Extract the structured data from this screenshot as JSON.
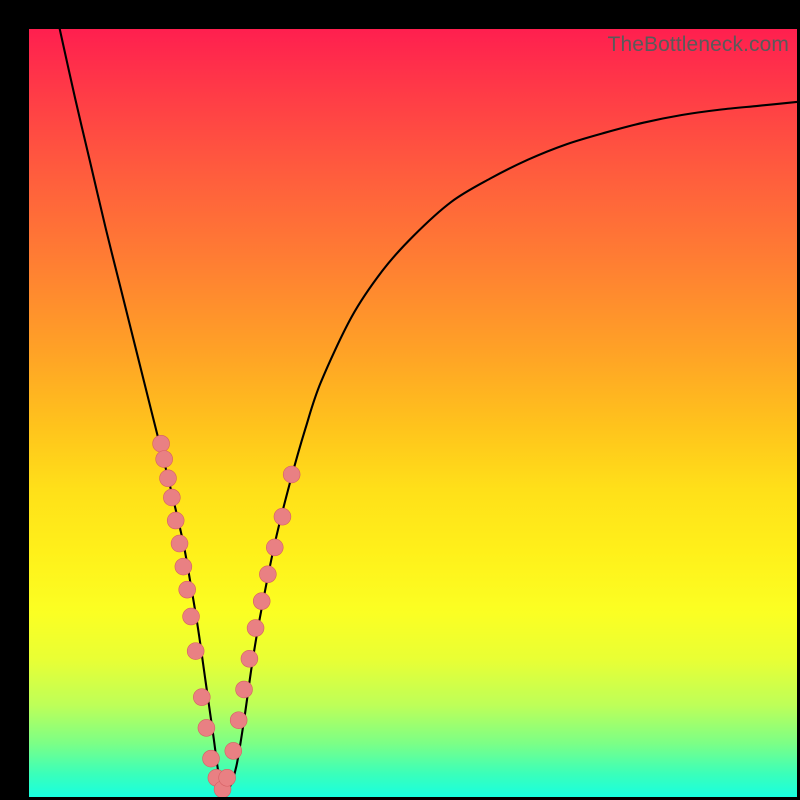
{
  "watermark": "TheBottleneck.com",
  "chart_data": {
    "type": "line",
    "title": "",
    "xlabel": "",
    "ylabel": "",
    "xlim": [
      0,
      100
    ],
    "ylim": [
      0,
      100
    ],
    "series": [
      {
        "name": "bottleneck-curve",
        "x": [
          4.0,
          6.0,
          8.0,
          10.0,
          12.0,
          14.0,
          16.0,
          18.0,
          20.0,
          21.0,
          22.0,
          23.0,
          24.0,
          24.7,
          25.4,
          26.0,
          27.0,
          28.0,
          29.0,
          30.0,
          32.0,
          34.0,
          36.0,
          38.0,
          42.0,
          46.0,
          50.0,
          55.0,
          60.0,
          65.0,
          70.0,
          75.0,
          80.0,
          85.0,
          90.0,
          95.0,
          100.0
        ],
        "y": [
          100.0,
          91.0,
          82.5,
          74.0,
          66.0,
          58.0,
          50.0,
          42.0,
          33.5,
          28.0,
          22.0,
          15.0,
          8.0,
          3.0,
          1.0,
          1.0,
          4.0,
          10.0,
          17.0,
          23.0,
          33.0,
          41.0,
          48.0,
          54.0,
          62.5,
          68.5,
          73.0,
          77.5,
          80.5,
          83.0,
          85.0,
          86.5,
          87.8,
          88.8,
          89.5,
          90.0,
          90.5
        ]
      }
    ],
    "marker_clusters": [
      {
        "name": "left-descending-cluster",
        "x": [
          17.2,
          17.6,
          18.1,
          18.6,
          19.1,
          19.6,
          20.1,
          20.6,
          21.1,
          21.7,
          22.5,
          23.1,
          23.7,
          24.4
        ],
        "y": [
          46.0,
          44.0,
          41.5,
          39.0,
          36.0,
          33.0,
          30.0,
          27.0,
          23.5,
          19.0,
          13.0,
          9.0,
          5.0,
          2.5
        ]
      },
      {
        "name": "right-ascending-cluster",
        "x": [
          25.2,
          25.8,
          26.6,
          27.3,
          28.0,
          28.7,
          29.5,
          30.3,
          31.1,
          32.0,
          33.0,
          34.2
        ],
        "y": [
          1.0,
          2.5,
          6.0,
          10.0,
          14.0,
          18.0,
          22.0,
          25.5,
          29.0,
          32.5,
          36.5,
          42.0
        ]
      }
    ],
    "marker_radius_plot_units": 1.1,
    "curve_stroke": "#000000",
    "curve_stroke_width": 2.1,
    "marker_fill": "#e98083",
    "marker_stroke": "#d65f63"
  }
}
